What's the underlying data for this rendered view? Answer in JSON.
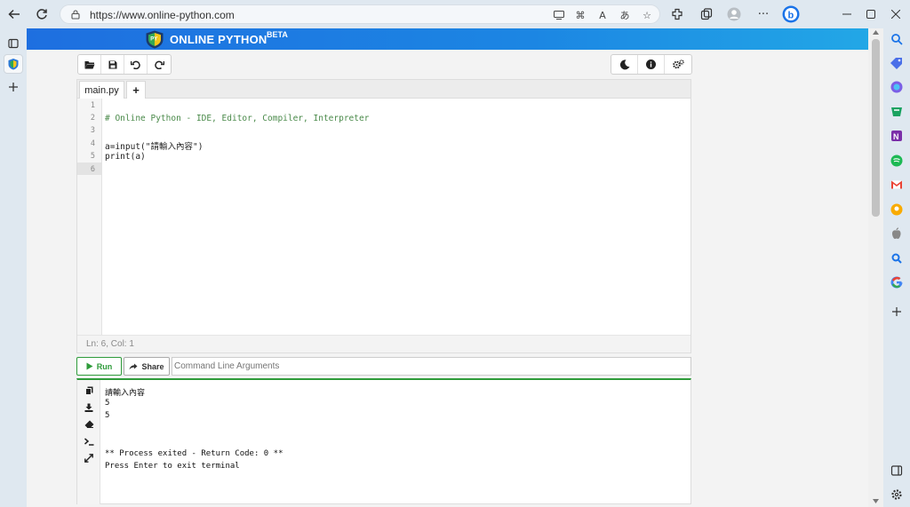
{
  "browser": {
    "url": "https://www.online-python.com",
    "addressbar_icons": [
      "app-available-icon",
      "extensions-grid-icon",
      "read-aloud-icon",
      "translate-icon",
      "favorite-add-icon"
    ],
    "toolbar_icons": [
      "extensions-icon",
      "collections-icon",
      "profile-icon",
      "more-icon",
      "copilot-icon"
    ],
    "window_controls": [
      "minimize-icon",
      "maximize-icon",
      "close-icon"
    ],
    "vertical_tabs": [
      "tab-actions-icon",
      "active-tab-favicon",
      "new-tab-icon"
    ],
    "sidebar_icons": [
      "search-icon",
      "shopping-icon",
      "copilot-icon",
      "games-icon",
      "onenote-icon",
      "spotify-icon",
      "gmail-icon",
      "keep-icon",
      "apple-icon",
      "search-app-icon",
      "google-icon",
      "add-icon",
      "sidebar-toggle-icon",
      "settings-icon"
    ]
  },
  "site": {
    "title": "ONLINE PYTHON",
    "badge": "BETA",
    "brand_color": "#1e6fe0"
  },
  "toolbar": {
    "left_buttons": [
      "open-file-icon",
      "save-icon",
      "undo-icon",
      "redo-icon"
    ],
    "right_buttons": [
      "dark-mode-icon",
      "info-icon",
      "settings-icon"
    ]
  },
  "editor": {
    "tab_label": "main.py",
    "add_tab_label": "+",
    "line_numbers": [
      "1",
      "2",
      "3",
      "4",
      "5",
      "6"
    ],
    "lines": [
      "",
      "# Online Python - IDE, Editor, Compiler, Interpreter",
      "",
      "a=input(\"請輸入內容\")",
      "print(a)",
      ""
    ],
    "status": "Ln: 6,  Col: 1"
  },
  "runbar": {
    "run_label": "Run",
    "share_label": "Share",
    "args_placeholder": "Command Line Arguments"
  },
  "terminal": {
    "tools": [
      "copy-icon",
      "download-icon",
      "eraser-icon",
      "terminal-icon",
      "expand-icon"
    ],
    "lines": [
      "請輸入內容",
      "5",
      "5",
      "",
      "",
      "** Process exited - Return Code: 0 **",
      "Press Enter to exit terminal"
    ]
  }
}
